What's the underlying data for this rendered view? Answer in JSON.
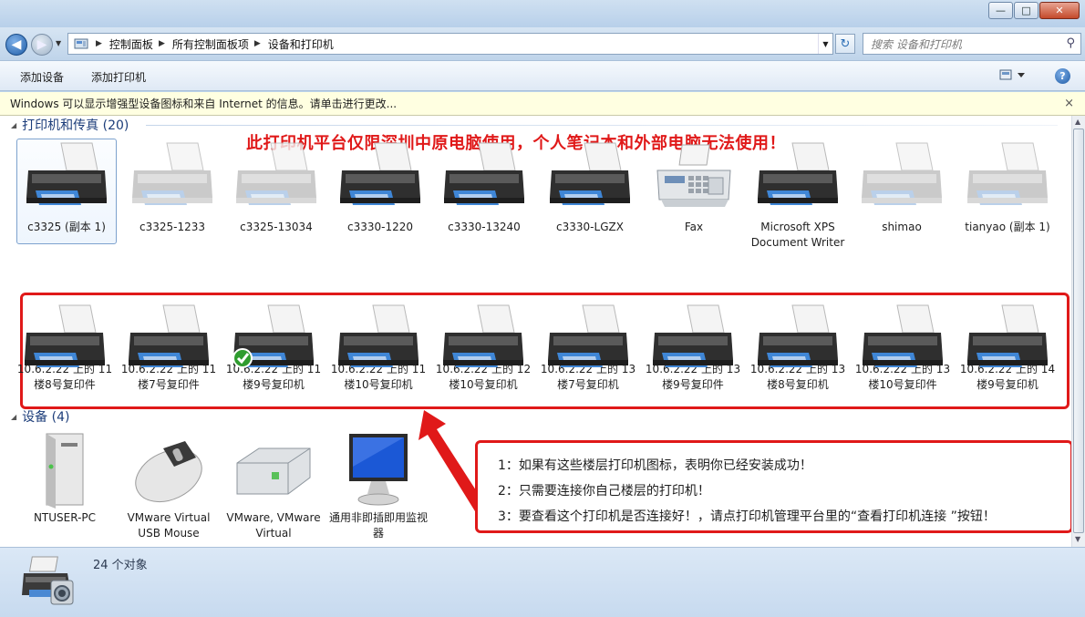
{
  "window": {
    "minimize_glyph": "—",
    "maximize_glyph": "□",
    "close_glyph": "✕"
  },
  "address": {
    "crumbs": [
      "控制面板",
      "所有控制面板项",
      "设备和打印机"
    ],
    "search_placeholder": "搜索 设备和打印机"
  },
  "toolbar": {
    "add_device": "添加设备",
    "add_printer": "添加打印机",
    "help": "?"
  },
  "infobar": {
    "text": "Windows 可以显示增强型设备图标和来自 Internet 的信息。请单击进行更改...",
    "close": "×"
  },
  "printers_group": {
    "title": "打印机和传真 (20)"
  },
  "banner": "此打印机平台仅限深圳中原电脑使用，个人笔记本和外部电脑无法使用！",
  "printers_row1": [
    {
      "label": "c3325 (副本 1)",
      "style": "dark"
    },
    {
      "label": "c3325-1233",
      "style": "faded"
    },
    {
      "label": "c3325-13034",
      "style": "faded"
    },
    {
      "label": "c3330-1220",
      "style": "dark"
    },
    {
      "label": "c3330-13240",
      "style": "dark"
    },
    {
      "label": "c3330-LGZX",
      "style": "dark"
    },
    {
      "label": "Fax",
      "style": "fax"
    },
    {
      "label": "Microsoft XPS Document Writer",
      "style": "dark"
    },
    {
      "label": "shimao",
      "style": "faded"
    },
    {
      "label": "tianyao (副本 1)",
      "style": "faded"
    }
  ],
  "printers_row2": [
    {
      "label": "10.6.2.22 上的 11楼8号复印件",
      "default": false
    },
    {
      "label": "10.6.2.22 上的 11楼7号复印件",
      "default": false
    },
    {
      "label": "10.6.2.22 上的 11楼9号复印机",
      "default": true
    },
    {
      "label": "10.6.2.22 上的 11楼10号复印机",
      "default": false
    },
    {
      "label": "10.6.2.22 上的 12楼10号复印机",
      "default": false
    },
    {
      "label": "10.6.2.22 上的 13楼7号复印机",
      "default": false
    },
    {
      "label": "10.6.2.22 上的 13楼9号复印件",
      "default": false
    },
    {
      "label": "10.6.2.22 上的 13楼8号复印机",
      "default": false
    },
    {
      "label": "10.6.2.22 上的 13楼10号复印件",
      "default": false
    },
    {
      "label": "10.6.2.22 上的 14楼9号复印机",
      "default": false
    }
  ],
  "devices_group": {
    "title": "设备 (4)"
  },
  "devices": [
    {
      "label": "NTUSER-PC",
      "icon": "pc-tower-icon"
    },
    {
      "label": "VMware Virtual USB Mouse",
      "icon": "mouse-icon"
    },
    {
      "label": "VMware, VMware Virtual",
      "icon": "hard-drive-icon"
    },
    {
      "label": "通用非即插即用监视器",
      "icon": "monitor-icon"
    }
  ],
  "notes": [
    "1：如果有这些楼层打印机图标，表明你已经安装成功！",
    "2：只需要连接你自己楼层的打印机！",
    "3：要查看这个打印机是否连接好！，请点打印机管理平台里的“查看打印机连接 ”按钮！"
  ],
  "status": {
    "count": "24 个对象"
  },
  "colors": {
    "annotation_red": "#e01919",
    "group_heading": "#1c3d7a",
    "infobar_bg": "#ffffe1"
  }
}
